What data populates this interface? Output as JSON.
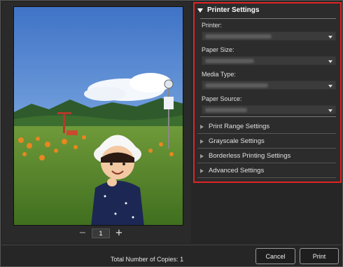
{
  "preview": {
    "copies_value": "1",
    "minus_symbol": "−",
    "plus_symbol": "+"
  },
  "printer_settings": {
    "title": "Printer Settings",
    "fields": [
      {
        "label": "Printer:",
        "value_blurred": true
      },
      {
        "label": "Paper Size:",
        "value_blurred": true
      },
      {
        "label": "Media Type:",
        "value_blurred": true
      },
      {
        "label": "Paper Source:",
        "value_blurred": true
      }
    ]
  },
  "sections": [
    {
      "label": "Print Range Settings"
    },
    {
      "label": "Grayscale Settings"
    },
    {
      "label": "Borderless Printing Settings"
    },
    {
      "label": "Advanced Settings"
    }
  ],
  "footer": {
    "total_copies_label": "Total Number of Copies:",
    "total_copies_value": "1",
    "cancel_label": "Cancel",
    "print_label": "Print"
  },
  "colors": {
    "highlight_border": "#e02424",
    "background": "#262626"
  }
}
